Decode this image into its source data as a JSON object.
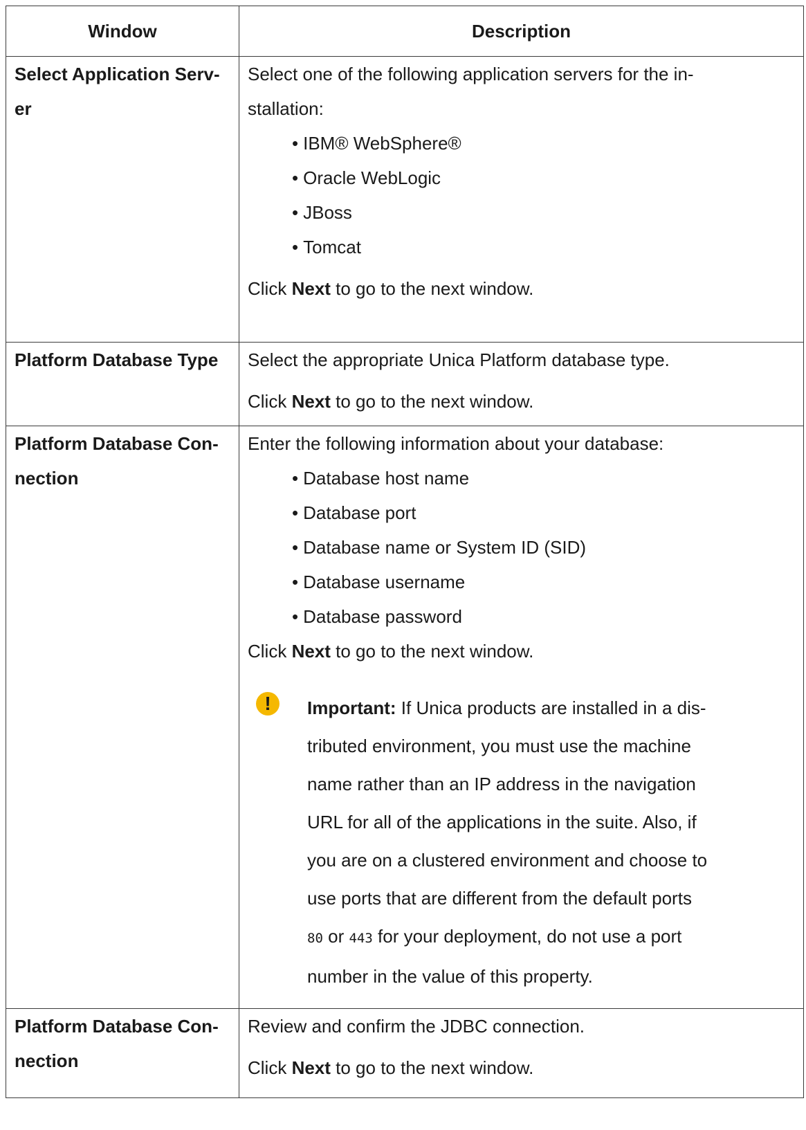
{
  "headers": {
    "window": "Window",
    "description": "Description"
  },
  "rows": [
    {
      "window": "Select Application Serv-\ner",
      "intro": "Select one of the following application servers for the in-\nstallation:",
      "bullets": [
        "IBM® WebSphere®",
        "Oracle WebLogic",
        "JBoss",
        "Tomcat"
      ],
      "click_prefix": "Click ",
      "click_bold": "Next",
      "click_suffix": " to go to the next window."
    },
    {
      "window": "Platform Database Type",
      "intro": "Select the appropriate Unica Platform database type.",
      "click_prefix": "Click ",
      "click_bold": "Next",
      "click_suffix": " to go to the next window."
    },
    {
      "window": "Platform Database Con-\nnection",
      "intro": "Enter the following information about your database:",
      "bullets": [
        "Database host name",
        "Database port",
        "Database name or System ID (SID)",
        "Database username",
        "Database password"
      ],
      "click_prefix": "Click ",
      "click_bold": "Next",
      "click_suffix": " to go to the next window.",
      "note": {
        "icon": "exclamation-icon",
        "icon_color": "#f5b800",
        "label": "Important:",
        "text_1": " If Unica products are installed in a dis-\ntributed environment, you must use the machine\nname rather than an IP address in the navigation\nURL for all of the applications in the suite. Also, if\nyou are on a clustered environment and choose to\nuse ports that are different from the default ports\n",
        "port_1": "80",
        "or": " or ",
        "port_2": "443",
        "text_2": " for your deployment, do not use a port\nnumber in the value of this property."
      }
    },
    {
      "window": "Platform Database Con-\nnection",
      "intro": "Review and confirm the JDBC connection.",
      "click_prefix": "Click ",
      "click_bold": "Next",
      "click_suffix": " to go to the next window."
    }
  ]
}
